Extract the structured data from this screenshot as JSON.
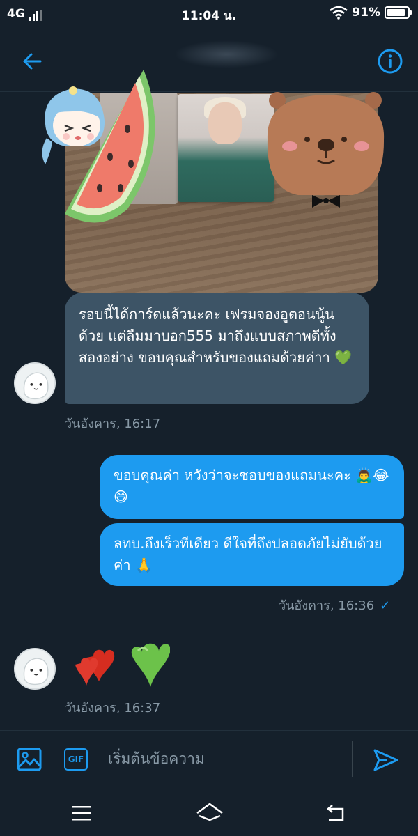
{
  "status_bar": {
    "network": "4G",
    "time": "11:04 น.",
    "battery_percent": "91%",
    "battery_level": 0.91,
    "icons": [
      "signal-icon",
      "wifi-icon",
      "battery-icon"
    ]
  },
  "header": {
    "back_icon": "arrow-left-icon",
    "info_icon": "info-circle-icon"
  },
  "conversation": {
    "received_photo": {
      "stickers": [
        "watermelon-sticker",
        "girl-sticker",
        "bear-sticker"
      ]
    },
    "received_message": {
      "text": "รอบนี้ได้การ์ดแล้วนะคะ เฟรมจองอูตอนนู้นด้วย แต่ลืมมาบอก555 มาถึงแบบสภาพดีทั้งสองอย่าง ขอบคุณสำหรับของแถมด้วยค่าา 💚",
      "time": "วันอังคาร, 16:17"
    },
    "sent_messages": [
      {
        "text": "ขอบคุณค่า หวังว่าจะชอบของแถมนะคะ 🙇‍♂️😂😄"
      },
      {
        "text": "ลทบ.ถึงเร็วทีเดียว ดีใจที่ถึงปลอดภัยไม่ยับด้วยค่า 🙏"
      }
    ],
    "sent_time": "วันอังคาร, 16:36",
    "read_check": "✓",
    "received_reaction": {
      "emoji": "💕💚",
      "time": "วันอังคาร, 16:37"
    }
  },
  "composer": {
    "image_icon": "image-icon",
    "gif_label": "GIF",
    "placeholder": "เริ่มต้นข้อความ",
    "send_icon": "send-icon"
  },
  "navbar": {
    "icons": [
      "menu-icon",
      "home-icon",
      "back-icon"
    ]
  },
  "colors": {
    "background": "#15202b",
    "received_bubble": "#3d5466",
    "sent_bubble": "#1d9bf0",
    "accent": "#1d9bf0",
    "muted_text": "#8899a6"
  }
}
